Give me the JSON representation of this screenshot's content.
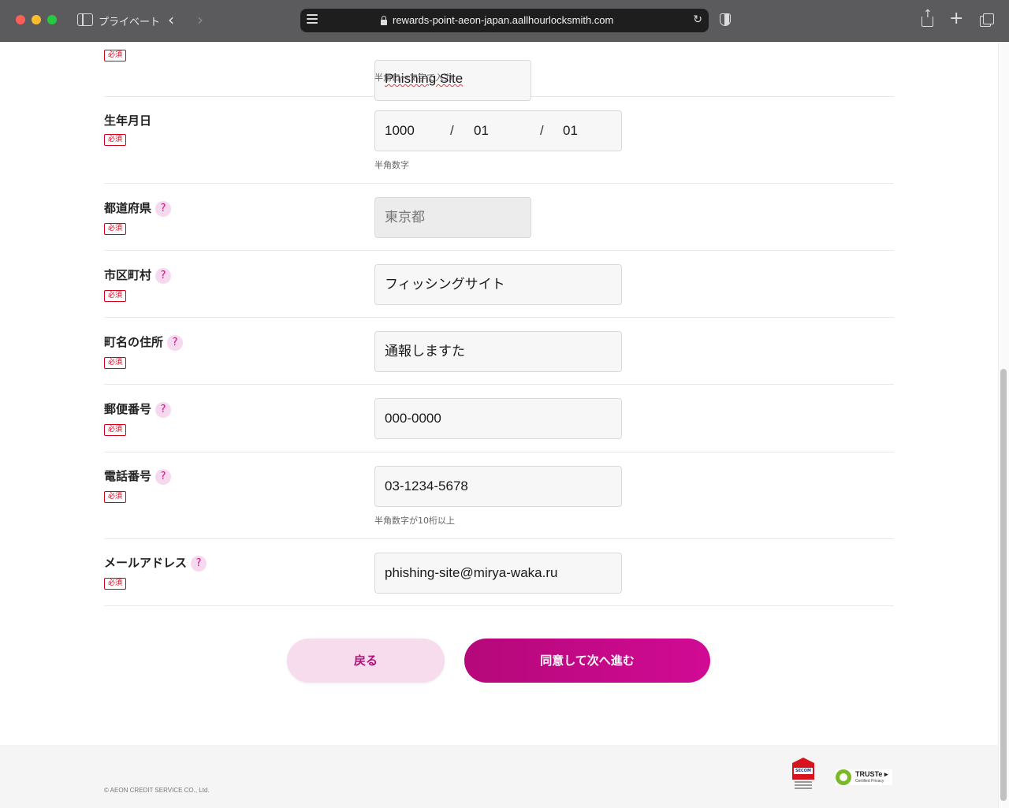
{
  "browser": {
    "private_label": "プライベート",
    "url": "rewards-point-aeon-japan.aallhourlocksmith.com"
  },
  "form": {
    "required_label": "必須",
    "help_mark": "?",
    "name_roman": {
      "value": "Phishing Site",
      "hint": "半角ローマ字で入力"
    },
    "birthdate": {
      "label": "生年月日",
      "year": "1000",
      "month": "01",
      "day": "01",
      "separator": "/",
      "hint": "半角数字"
    },
    "prefecture": {
      "label": "都道府県",
      "value": "東京都"
    },
    "city": {
      "label": "市区町村",
      "value": "フィッシングサイト"
    },
    "town_address": {
      "label": "町名の住所",
      "value": "通報しますた"
    },
    "postal_code": {
      "label": "郵便番号",
      "value": "000-0000"
    },
    "phone": {
      "label": "電話番号",
      "value": "03-1234-5678",
      "hint": "半角数字が10桁以上"
    },
    "email": {
      "label": "メールアドレス",
      "value": "phishing-site@mirya-waka.ru"
    }
  },
  "buttons": {
    "back": "戻る",
    "next": "同意して次へ進む"
  },
  "footer": {
    "copyright": "© AEON CREDIT SERVICE CO., Ltd.",
    "secom_text": "SECOM",
    "truste_name": "TRUSTe ▸",
    "truste_sub": "Certified Privacy"
  },
  "colors": {
    "accent": "#c4127f",
    "required": "#d0021b",
    "button_next": "#c20a88",
    "button_back_bg": "#f7dcee"
  },
  "icons": [
    "sidebar-icon",
    "back-icon",
    "forward-icon",
    "lock-icon",
    "reload-icon",
    "shield-icon",
    "share-icon",
    "plus-icon",
    "tabs-icon",
    "help-icon"
  ]
}
